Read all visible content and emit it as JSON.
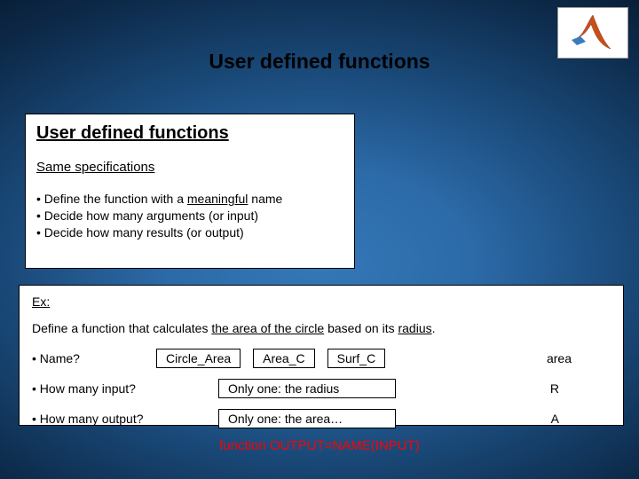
{
  "logo_name": "matlab-logo",
  "slide_title": "User defined functions",
  "box1": {
    "title": "User defined functions",
    "subtitle": "Same specifications",
    "bullets": [
      {
        "prefix": "• Define the function with a ",
        "emph": "meaningful",
        "suffix": " name"
      },
      {
        "prefix": "• Decide how many arguments (or input)",
        "emph": "",
        "suffix": ""
      },
      {
        "prefix": "• Decide how many results (or output)",
        "emph": "",
        "suffix": ""
      }
    ]
  },
  "box2": {
    "ex_label": "Ex:",
    "prompt_pre": "Define a function that calculates ",
    "prompt_u1": "the area of the circle",
    "prompt_mid": " based on its ",
    "prompt_u2": "radius",
    "prompt_post": ".",
    "q_name": "• Name?",
    "name_options": [
      "Circle_Area",
      "Area_C",
      "Surf_C"
    ],
    "name_answer": "area",
    "q_input": "• How many input?",
    "input_answer": "Only one:  the radius",
    "input_var": "R",
    "q_output": "• How many output?",
    "output_answer": "Only one:   the area…",
    "output_var": "A"
  },
  "fn_line": "function  OUTPUT=NAME(INPUT)"
}
